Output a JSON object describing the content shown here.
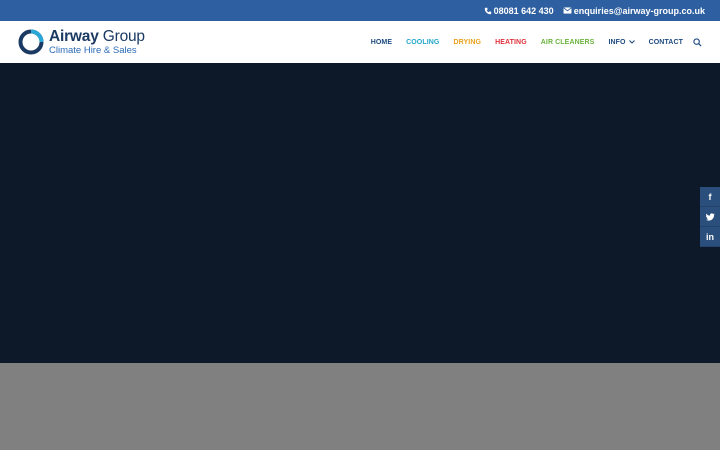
{
  "topbar": {
    "phone": "08081 642 430",
    "email": "enquiries@airway-group.co.uk",
    "phone_icon": "phone-icon",
    "email_icon": "envelope-icon"
  },
  "logo": {
    "brand_bold": "Airway",
    "brand_light": "Group",
    "tagline": "Climate Hire & Sales"
  },
  "nav": {
    "items": [
      {
        "label": "HOME",
        "color": "#1d4a7f"
      },
      {
        "label": "COOLING",
        "color": "#23a7c9"
      },
      {
        "label": "DRYING",
        "color": "#e9a21c"
      },
      {
        "label": "HEATING",
        "color": "#e0303a"
      },
      {
        "label": "AIR CLEANERS",
        "color": "#6cb33e"
      },
      {
        "label": "INFO",
        "color": "#1d4a7f"
      },
      {
        "label": "CONTACT",
        "color": "#1d4a7f"
      }
    ],
    "search_icon": "search-icon"
  },
  "social": {
    "facebook": "f",
    "twitter_icon": "twitter-icon",
    "linkedin": "in"
  },
  "colors": {
    "topbar_bg": "#2e5fa0",
    "hero_bg": "#0d1829",
    "band_bg": "#808080",
    "social_bg": "#2b4f7c"
  }
}
